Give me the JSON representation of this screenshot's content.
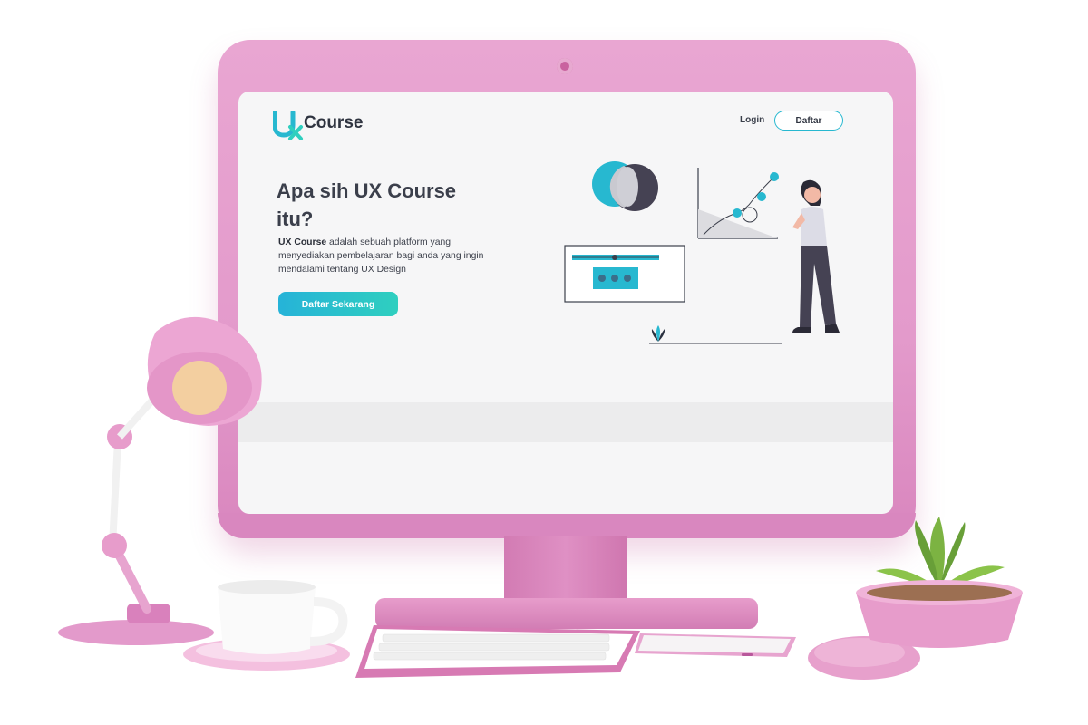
{
  "site": {
    "logo": {
      "mark": "Ux",
      "text": "Course"
    },
    "nav": {
      "login_label": "Login",
      "register_label": "Daftar"
    },
    "hero": {
      "title": "Apa sih UX Course itu?",
      "description_bold": "UX Course",
      "description_rest": " adalah sebuah platform yang menyediakan pembelajaran bagi anda yang ingin mendalami tentang UX Design",
      "cta_label": "Daftar Sekarang"
    }
  },
  "colors": {
    "accent_teal": "#27b8d0",
    "accent_cyan": "#2fcfbf",
    "text_dark": "#3b3f4b",
    "screen_bg": "#f6f6f7",
    "monitor_pink": "#e39acb"
  },
  "icons": [
    "ux-course-logo-icon",
    "venn-diagram-icon",
    "growth-chart-icon",
    "slider-window-icon",
    "woman-figure-icon",
    "leaf-plant-icon"
  ]
}
